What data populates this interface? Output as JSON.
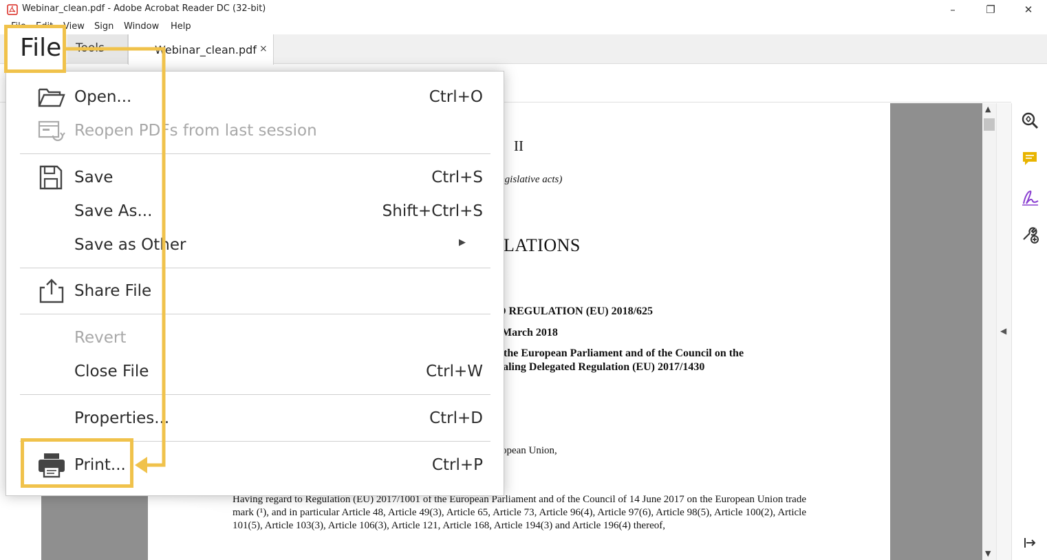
{
  "window": {
    "title": "Webinar_clean.pdf - Adobe Acrobat Reader DC (32-bit)",
    "minimize": "–",
    "restore": "❐",
    "close": "✕"
  },
  "menubar": {
    "items": [
      "File",
      "Edit",
      "View",
      "Sign",
      "Window",
      "Help"
    ]
  },
  "tabs": {
    "tools": "Tools",
    "document": "Webinar_clean.pdf",
    "document_close": "×"
  },
  "file_highlight": "File",
  "file_menu": {
    "open": {
      "label": "Open...",
      "shortcut": "Ctrl+O"
    },
    "reopen": {
      "label": "Reopen PDFs from last session"
    },
    "save": {
      "label": "Save",
      "shortcut": "Ctrl+S"
    },
    "save_as": {
      "label": "Save As...",
      "shortcut": "Shift+Ctrl+S"
    },
    "save_as_other": {
      "label": "Save as Other"
    },
    "share": {
      "label": "Share File"
    },
    "revert": {
      "label": "Revert"
    },
    "close_file": {
      "label": "Close File",
      "shortcut": "Ctrl+W"
    },
    "properties": {
      "label": "Properties...",
      "shortcut": "Ctrl+D"
    },
    "print": {
      "label": "Print...",
      "shortcut": "Ctrl+P"
    }
  },
  "document": {
    "roman": "II",
    "legislative": "egislative acts)",
    "regulations": "LATIONS",
    "b1": "D REGULATION (EU) 2018/625",
    "b2": "March 2018",
    "b3": "the European Parliament and of the Council on the",
    "b4": "ealing Delegated Regulation (EU) 2017/1430",
    "union": "ropean Union,",
    "paragraph": "Having regard to Regulation (EU) 2017/1001 of the European Parliament and of the Council of 14 June 2017 on the European Union trade mark (¹), and in particular Article 48, Article 49(3), Article 65, Article 73, Article 96(4), Article 97(6), Article 98(5), Article 100(2), Article 101(5), Article 103(3), Article 106(3), Article 121, Article 168, Article 194(3) and Article 196(4) thereof,"
  },
  "colors": {
    "highlight": "#f0c24b",
    "comment_icon": "#e8b400",
    "sign_icon": "#8a3fd1"
  },
  "icons": [
    "pdf-app-icon",
    "open-folder-icon",
    "reopen-icon",
    "save-icon",
    "share-icon",
    "printer-icon",
    "zoom-icon",
    "comment-icon",
    "sign-icon",
    "tools-icon",
    "scroll-up-icon",
    "scroll-down-icon",
    "collapse-panel-icon",
    "exit-panel-icon"
  ]
}
